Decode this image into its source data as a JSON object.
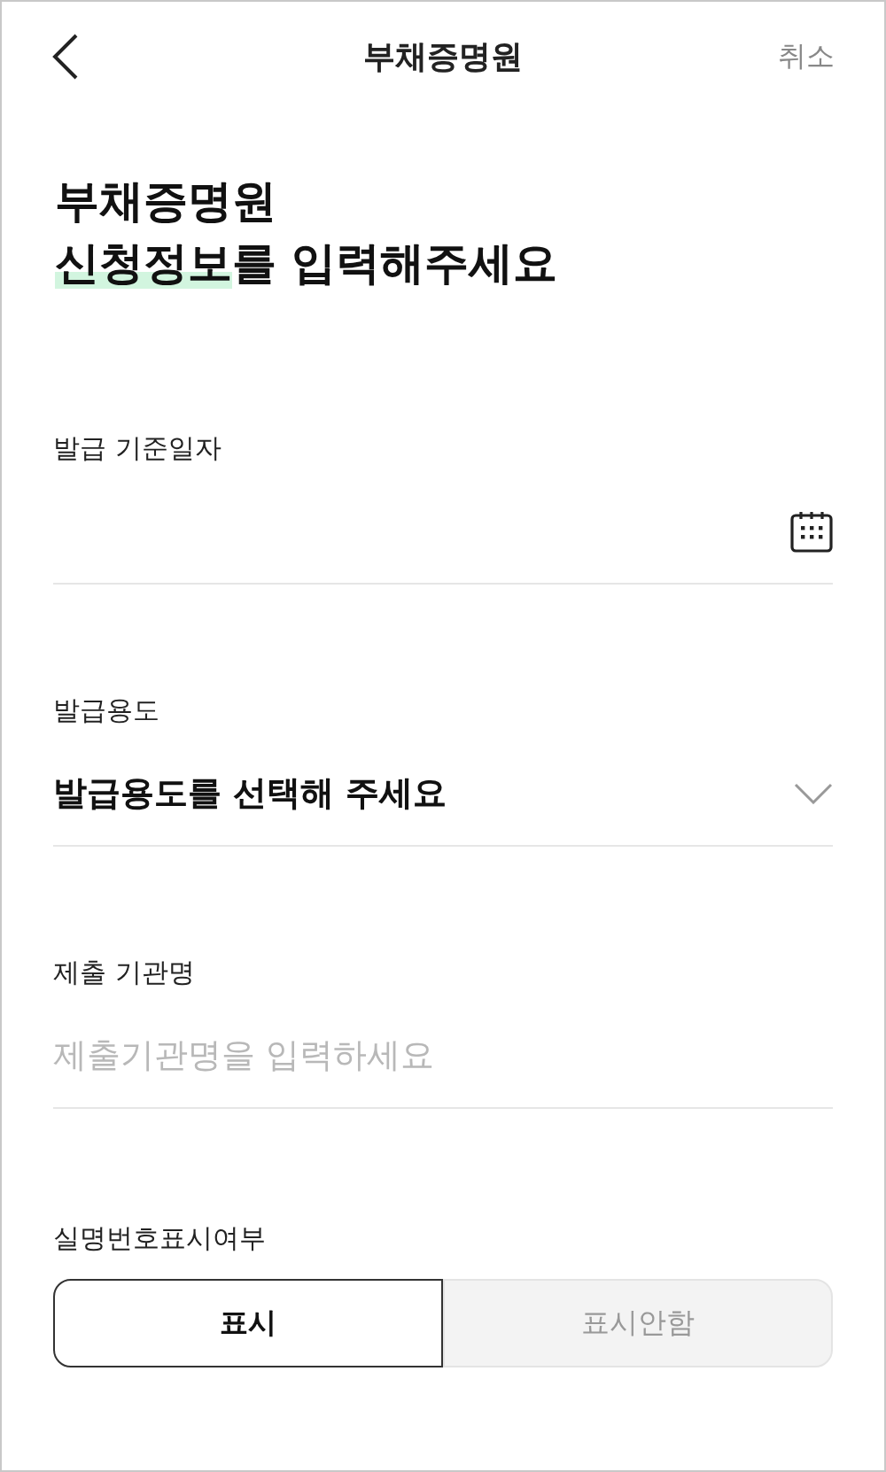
{
  "header": {
    "back_icon": true,
    "title": "부채증명원",
    "cancel": "취소"
  },
  "heading": {
    "line_1": "부채증명원",
    "highlight": "신청정보",
    "line_2_rest": "를 입력해주세요"
  },
  "fields": [
    {
      "kind": "date",
      "label": "발급 기준일자"
    },
    {
      "kind": "select",
      "label": "발급용도",
      "value": "발급용도를 선택해 주세요"
    },
    {
      "kind": "text",
      "label": "제출 기관명",
      "placeholder": "제출기관명을 입력하세요"
    },
    {
      "kind": "segmented",
      "label": "실명번호표시여부",
      "options": [
        {
          "label": "표시",
          "selected": true
        },
        {
          "label": "표시안함",
          "selected": false
        }
      ]
    }
  ]
}
